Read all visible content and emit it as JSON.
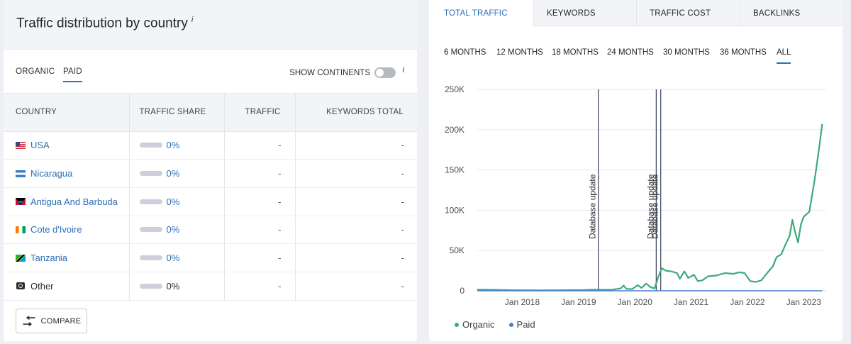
{
  "left_panel": {
    "title": "Traffic distribution by country",
    "title_info": "i",
    "tabs": [
      "ORGANIC",
      "PAID"
    ],
    "active_tab": "PAID",
    "show_continents_label": "SHOW CONTINENTS",
    "show_continents_info": "i",
    "columns": [
      "COUNTRY",
      "TRAFFIC SHARE",
      "TRAFFIC",
      "KEYWORDS TOTAL"
    ],
    "rows": [
      {
        "country": "USA",
        "flag": "usa",
        "share": "0%",
        "traffic": "-",
        "keywords": "-",
        "link": true
      },
      {
        "country": "Nicaragua",
        "flag": "nicaragua",
        "share": "0%",
        "traffic": "-",
        "keywords": "-",
        "link": true
      },
      {
        "country": "Antigua And Barbuda",
        "flag": "antigua",
        "share": "0%",
        "traffic": "-",
        "keywords": "-",
        "link": true
      },
      {
        "country": "Cote d'Ivoire",
        "flag": "ivory-coast",
        "share": "0%",
        "traffic": "-",
        "keywords": "-",
        "link": true
      },
      {
        "country": "Tanzania",
        "flag": "tanzania",
        "share": "0%",
        "traffic": "-",
        "keywords": "-",
        "link": true
      },
      {
        "country": "Other",
        "flag": "globe",
        "share": "0%",
        "traffic": "-",
        "keywords": "-",
        "link": false
      }
    ],
    "compare_label": "COMPARE"
  },
  "right_panel": {
    "tabs": [
      "TOTAL TRAFFIC",
      "KEYWORDS",
      "TRAFFIC COST",
      "BACKLINKS"
    ],
    "active_tab": "TOTAL TRAFFIC",
    "periods": [
      "6 MONTHS",
      "12 MONTHS",
      "18 MONTHS",
      "24 MONTHS",
      "30 MONTHS",
      "36 MONTHS",
      "ALL"
    ],
    "active_period": "ALL"
  },
  "chart_data": {
    "type": "line",
    "y_ticks": [
      "250K",
      "200K",
      "150K",
      "100K",
      "50K",
      "0"
    ],
    "ylim": [
      0,
      250000
    ],
    "x_ticks": [
      "Jan 2018",
      "Jan 2019",
      "Jan 2020",
      "Jan 2021",
      "Jan 2022",
      "Jan 2023"
    ],
    "x_range": [
      2017.2,
      2023.4
    ],
    "grid": true,
    "annotations": [
      {
        "label": "Database update",
        "x": 2019.35
      },
      {
        "label": "Database update",
        "x": 2020.38
      },
      {
        "label": "Database update",
        "x": 2020.46
      }
    ],
    "series": [
      {
        "name": "Organic",
        "color": "#3daa7a",
        "points": [
          [
            2017.2,
            1500
          ],
          [
            2017.5,
            1200
          ],
          [
            2017.8,
            800
          ],
          [
            2018.0,
            700
          ],
          [
            2018.3,
            600
          ],
          [
            2018.6,
            700
          ],
          [
            2018.9,
            900
          ],
          [
            2019.1,
            1000
          ],
          [
            2019.3,
            1400
          ],
          [
            2019.45,
            1200
          ],
          [
            2019.6,
            1500
          ],
          [
            2019.75,
            3000
          ],
          [
            2019.8,
            6500
          ],
          [
            2019.85,
            2500
          ],
          [
            2019.95,
            2000
          ],
          [
            2020.05,
            7000
          ],
          [
            2020.12,
            3500
          ],
          [
            2020.2,
            9000
          ],
          [
            2020.28,
            4500
          ],
          [
            2020.35,
            3000
          ],
          [
            2020.42,
            18000
          ],
          [
            2020.48,
            28000
          ],
          [
            2020.55,
            25000
          ],
          [
            2020.65,
            24000
          ],
          [
            2020.75,
            22000
          ],
          [
            2020.8,
            15000
          ],
          [
            2020.88,
            24000
          ],
          [
            2020.95,
            16000
          ],
          [
            2021.05,
            20000
          ],
          [
            2021.12,
            12000
          ],
          [
            2021.2,
            13000
          ],
          [
            2021.3,
            18000
          ],
          [
            2021.45,
            19000
          ],
          [
            2021.6,
            22000
          ],
          [
            2021.75,
            21000
          ],
          [
            2021.85,
            23000
          ],
          [
            2021.95,
            22000
          ],
          [
            2022.05,
            12000
          ],
          [
            2022.15,
            11000
          ],
          [
            2022.25,
            13000
          ],
          [
            2022.35,
            22000
          ],
          [
            2022.45,
            30000
          ],
          [
            2022.52,
            42000
          ],
          [
            2022.6,
            45000
          ],
          [
            2022.68,
            58000
          ],
          [
            2022.75,
            68000
          ],
          [
            2022.8,
            88000
          ],
          [
            2022.85,
            72000
          ],
          [
            2022.9,
            60000
          ],
          [
            2022.95,
            82000
          ],
          [
            2023.0,
            92000
          ],
          [
            2023.1,
            98000
          ],
          [
            2023.2,
            140000
          ],
          [
            2023.28,
            180000
          ],
          [
            2023.33,
            207000
          ]
        ]
      },
      {
        "name": "Paid",
        "color": "#4a7fd4",
        "points": [
          [
            2017.2,
            0
          ],
          [
            2023.33,
            0
          ]
        ]
      }
    ]
  }
}
